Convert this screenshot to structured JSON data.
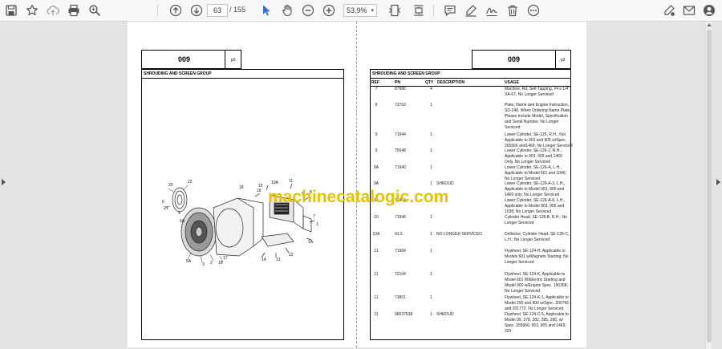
{
  "toolbar": {
    "icons": [
      "save-icon",
      "bookmark-star-icon",
      "upload-cloud-icon",
      "print-icon",
      "zoom-search-icon",
      "page-up-icon",
      "page-down-icon",
      "select-cursor-icon",
      "hand-pan-icon",
      "zoom-out-icon",
      "zoom-in-icon",
      "fit-page-icon",
      "scroll-mode-icon",
      "comment-icon",
      "highlight-pen-icon",
      "sign-icon",
      "delete-icon",
      "more-icon",
      "edit-pdf-icon",
      "email-icon",
      "account-icon"
    ],
    "current_page": "63",
    "page_separator": "/",
    "total_pages": "155",
    "zoom": "53,9%",
    "zoom_caret": "▾"
  },
  "left_page": {
    "section_number": "009",
    "page_label": "p2",
    "section_title": "SHROUDING AND SCREEN GROUP",
    "callouts": [
      "20",
      "21",
      "22",
      "6",
      "4",
      "6A",
      "5A",
      "3",
      "2",
      "16",
      "17",
      "18",
      "19",
      "15",
      "10A",
      "11",
      "9",
      "8",
      "7",
      "1",
      "1A",
      "14",
      "13",
      "12"
    ]
  },
  "right_page": {
    "section_number": "009",
    "page_label": "p2",
    "section_title": "SHROUDING AND SCREEN GROUP",
    "columns": {
      "ref": "REF",
      "pn": "PN",
      "qty": "QTY",
      "desc": "DESCRIPTION",
      "usage": "USAGE"
    },
    "rows": [
      {
        "ref": "7",
        "pn": "87986",
        "qty": "4",
        "desc": "",
        "usage": [
          "Machine, Rd, Self-Tapping, #4 x 1/4\",",
          "XA-67, No Longer Serviced"
        ]
      },
      {
        "ref": "8",
        "pn": "73762",
        "qty": "1",
        "desc": "",
        "usage": [
          "Plate, Name and Engine Instruction,",
          "SD-248, When Ordering Name Plate,",
          "Please Include Model, Specification",
          "and Serial Number, No Longer",
          "Serviced"
        ]
      },
      {
        "ref": "9",
        "pn": "71944",
        "qty": "1",
        "desc": "",
        "usage": [
          "Lower Cylinder, SE-126, R.H., Not",
          "Applicable to 903 and 905 w/Spec.",
          "265666 and1469; No Longer Serviced"
        ]
      },
      {
        "ref": "9",
        "pn": "75548",
        "qty": "1",
        "desc": "",
        "usage": [
          "Lower Cylinder, SE-126-2, R.H.,",
          "Applicable to 903, 905 and 1469",
          "Only, No Longer Serviced"
        ]
      },
      {
        "ref": "9A",
        "pn": "71940",
        "qty": "1",
        "desc": "",
        "usage": [
          "Lower Cylinder, SE-126-A, L.H.,",
          "Applicable to Model 601 and 1046;",
          "No Longer Serviced"
        ]
      },
      {
        "ref": "9A",
        "pn": "",
        "qty": "1",
        "desc": "SHROUD",
        "usage": [
          "Lower Cylinder, SE-126-A-3, L.H.,",
          "Applicable to Model 903, 905 and",
          "1469 only, No Longer Serviced"
        ]
      },
      {
        "ref": "9A",
        "pn": "75464",
        "qty": "1",
        "desc": "",
        "usage": [
          "Lower Cylinder, SE-126-A-8, L.H.,",
          "Applicable to Model 903, 905 and",
          "1038; No Longer Serviced"
        ]
      },
      {
        "ref": "10",
        "pn": "71946",
        "qty": "1",
        "desc": "",
        "usage": [
          "Cylinder Head, SE-128-B, R.H.; No",
          "Longer Serviced"
        ]
      },
      {
        "ref": "10A",
        "pn": "NLS",
        "qty": "1",
        "desc": "NO LONGER SERVICED",
        "usage": [
          "Deflector, Cylinder Head, SE-128-C,",
          "L.H.; No Longer Serviced"
        ]
      },
      {
        "ref": "11",
        "pn": "71984",
        "qty": "1",
        "desc": "",
        "usage": [
          "Flywheel, SE-124-H, Applicable to",
          "Models 601 w/Magneto Starting; No",
          "Longer Serviced"
        ]
      },
      {
        "ref": "11",
        "pn": "72104",
        "qty": "1",
        "desc": "",
        "usage": [
          "Flywheel, SE-124-K, Applicable to",
          "Model 601 W/Electric Starting and",
          "Model 900 w/Engine Spec. 190268;",
          "No Longer Serviced"
        ]
      },
      {
        "ref": "11",
        "pn": "73801",
        "qty": "1",
        "desc": "",
        "usage": [
          "Flywheel, SE-124-K-1, Applicable to",
          "Model 290 and 900 w/Spec. 200766",
          "and 201772; No Longer Serviced"
        ]
      },
      {
        "ref": "11",
        "pn": "96637638",
        "qty": "1",
        "desc": "SHROUD",
        "usage": [
          "Flywheel, SE-124-C-5, Applicable to",
          "Model 99, 278, 282, 285, 290, w/",
          "Spec. 265666, 903, 905 and 1469;",
          "320"
        ]
      }
    ]
  },
  "watermark": "machinecatalogic.com"
}
